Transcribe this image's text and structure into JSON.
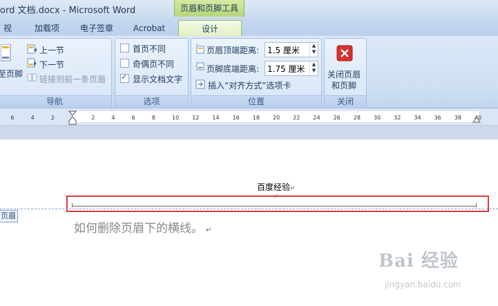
{
  "window": {
    "title": "ord 文档.docx - Microsoft Word",
    "context_tab_title": "页眉和页脚工具"
  },
  "tabs": [
    {
      "label": "视图"
    },
    {
      "label": "加载项"
    },
    {
      "label": "电子签章"
    },
    {
      "label": "Acrobat"
    },
    {
      "label": "设计",
      "active": true
    }
  ],
  "ribbon": {
    "nav_group": {
      "label": "导航",
      "goto_footer": "至页脚",
      "prev_section": "上一节",
      "next_section": "下一节",
      "link_to_previous": "链接到前一条页眉"
    },
    "options_group": {
      "label": "选项",
      "first_page_different": {
        "label": "首页不同",
        "checked": false
      },
      "odd_even_different": {
        "label": "奇偶页不同",
        "checked": false
      },
      "show_document_text": {
        "label": "显示文档文字",
        "checked": true
      }
    },
    "position_group": {
      "label": "位置",
      "header_from_top": {
        "label": "页眉顶端距离:",
        "value": "1.5 厘米"
      },
      "footer_from_bottom": {
        "label": "页脚底端距离:",
        "value": "1.75 厘米"
      },
      "insert_alignment_tab": "插入“对齐方式”选项卡"
    },
    "close_group": {
      "label": "关闭",
      "close_button_line1": "关闭页眉",
      "close_button_line2": "和页脚"
    }
  },
  "ruler": {
    "left_ticks": [
      "6",
      "4",
      "2"
    ],
    "right_ticks": [
      "2",
      "4",
      "6",
      "8",
      "10",
      "12",
      "14",
      "16",
      "18",
      "20",
      "22",
      "24",
      "26",
      "28",
      "30",
      "32",
      "34",
      "36",
      "38",
      "40"
    ]
  },
  "document": {
    "header_text": "百度经验",
    "header_label": "页眉",
    "body_text": "如何删除页眉下的横线。",
    "paragraph_mark": "↵"
  },
  "watermark": {
    "brand": "Bai 经验",
    "url": "jingyan.baidu.com"
  },
  "colors": {
    "annotation_red": "#e03a3a",
    "context_tab_green": "#b6d57a",
    "ribbon_blue": "#cfe0f4"
  }
}
